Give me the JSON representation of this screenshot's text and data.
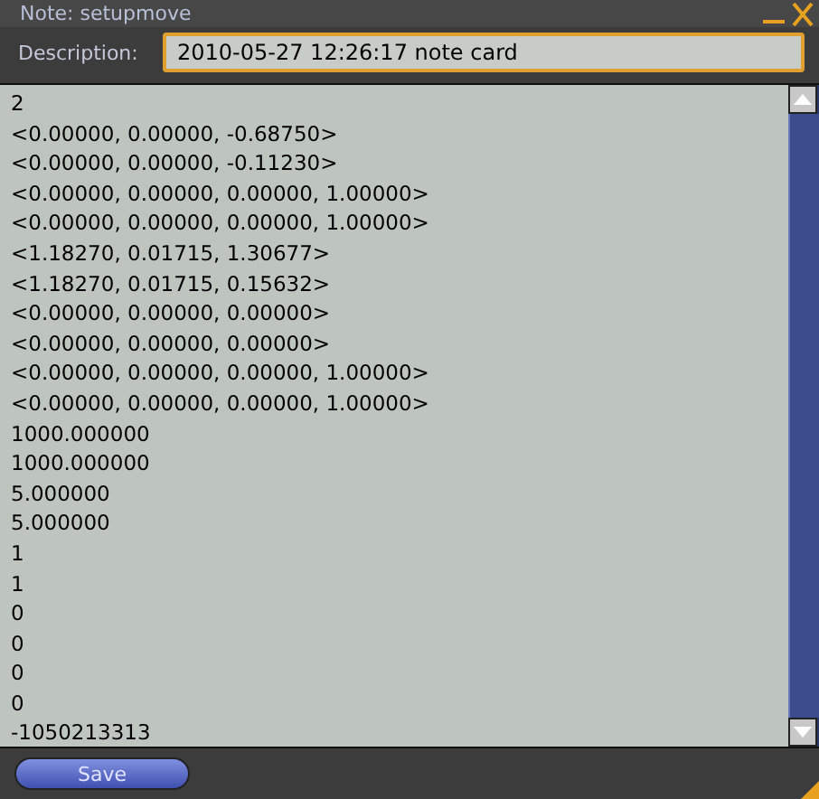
{
  "window": {
    "title": "Note: setupmove"
  },
  "description": {
    "label": "Description:",
    "value": "2010-05-27 12:26:17 note card"
  },
  "note_lines": [
    "2",
    "<0.00000, 0.00000, -0.68750>",
    "<0.00000, 0.00000, -0.11230>",
    "<0.00000, 0.00000, 0.00000, 1.00000>",
    "<0.00000, 0.00000, 0.00000, 1.00000>",
    "<1.18270, 0.01715, 1.30677>",
    "<1.18270, 0.01715, 0.15632>",
    "<0.00000, 0.00000, 0.00000>",
    "<0.00000, 0.00000, 0.00000>",
    "<0.00000, 0.00000, 0.00000, 1.00000>",
    "<0.00000, 0.00000, 0.00000, 1.00000>",
    "1000.000000",
    "1000.000000",
    "5.000000",
    "5.000000",
    "1",
    "1",
    "0",
    "0",
    "0",
    "0",
    "-1050213313"
  ],
  "buttons": [
    "Save"
  ]
}
